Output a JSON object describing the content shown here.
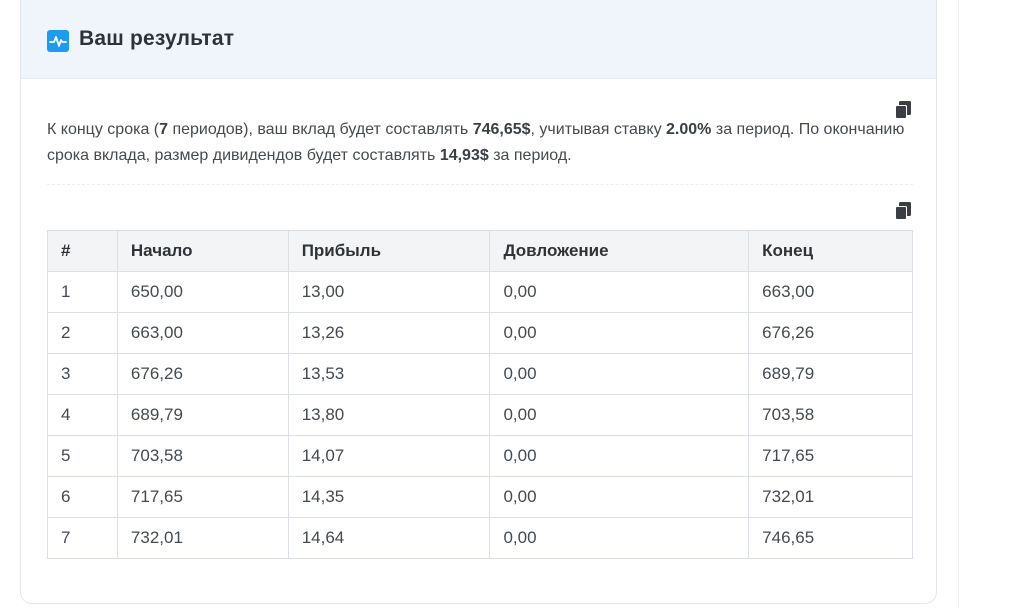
{
  "header": {
    "title": "Ваш результат",
    "icon": "activity-chart-icon",
    "icon_color": "#1d9bf0"
  },
  "summary": {
    "p1": "К концу срока (",
    "periods": "7",
    "p2": " периодов), ваш вклад будет составлять ",
    "total": "746,65$",
    "p3": ", учитывая ставку ",
    "rate": "2.00%",
    "p4": " за период. По окончанию срока вклада, размер дивидендов будет составлять ",
    "dividend": "14,93$",
    "p5": " за период."
  },
  "copy_icon": "copy-icon",
  "table": {
    "headers": [
      "#",
      "Начало",
      "Прибыль",
      "Довложение",
      "Конец"
    ],
    "rows": [
      [
        "1",
        "650,00",
        "13,00",
        "0,00",
        "663,00"
      ],
      [
        "2",
        "663,00",
        "13,26",
        "0,00",
        "676,26"
      ],
      [
        "3",
        "676,26",
        "13,53",
        "0,00",
        "689,79"
      ],
      [
        "4",
        "689,79",
        "13,80",
        "0,00",
        "703,58"
      ],
      [
        "5",
        "703,58",
        "14,07",
        "0,00",
        "717,65"
      ],
      [
        "6",
        "717,65",
        "14,35",
        "0,00",
        "732,01"
      ],
      [
        "7",
        "732,01",
        "14,64",
        "0,00",
        "746,65"
      ]
    ]
  }
}
